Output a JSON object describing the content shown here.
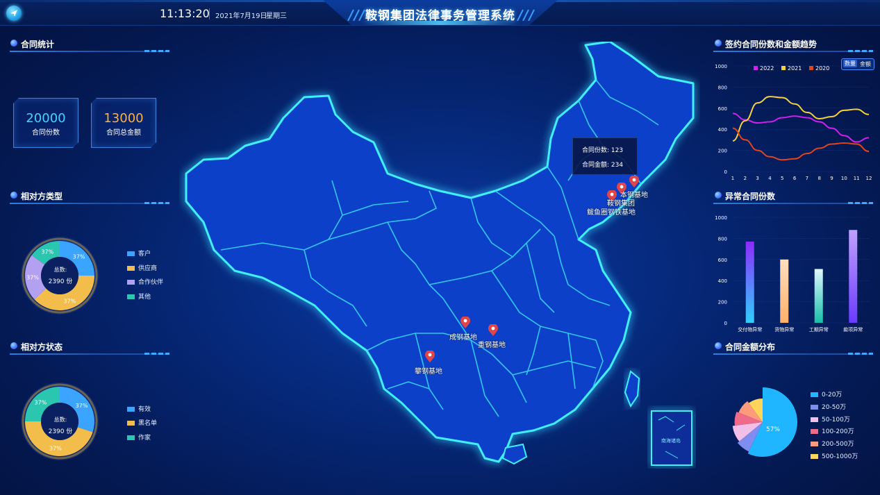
{
  "header": {
    "time": "11:13:20",
    "date": "2021年7月19日",
    "weekday": "星期三",
    "title": "鞍钢集团法律事务管理系统"
  },
  "left": {
    "contract_stats": {
      "title": "合同统计",
      "count_value": "20000",
      "count_label": "合同份数",
      "amount_value": "13000",
      "amount_label": "合同总金额"
    },
    "counterparty_type": {
      "title": "相对方类型",
      "center_label": "总数:",
      "center_value": "2390 份",
      "slice_labels": [
        "37%",
        "37%",
        "37%",
        "37%"
      ],
      "legend": [
        "客户",
        "供应商",
        "合作伙伴",
        "其他"
      ]
    },
    "counterparty_status": {
      "title": "相对方状态",
      "center_label": "总数:",
      "center_value": "2390 份",
      "slice_labels": [
        "37%",
        "37%",
        "37%"
      ],
      "legend": [
        "有效",
        "黑名单",
        "作家"
      ]
    }
  },
  "map": {
    "tooltip_count_label": "合同份数:",
    "tooltip_count_value": "123",
    "tooltip_amount_label": "合同金额:",
    "tooltip_amount_value": "234",
    "pins": [
      "本钢基地",
      "鞍钢集团",
      "鲅鱼圈钢铁基地",
      "成钢基地",
      "重钢基地",
      "攀钢基地"
    ],
    "inset_label": "南海诸岛"
  },
  "right": {
    "trend": {
      "title": "签约合同份数和金额趋势",
      "toggle_on": "数量",
      "toggle_off": "金额"
    },
    "abnormal": {
      "title": "异常合同份数"
    },
    "distribution": {
      "title": "合同金额分布",
      "slice_label": "57%",
      "legend": [
        "0-20万",
        "20-50万",
        "50-100万",
        "100-200万",
        "200-500万",
        "500-1000万"
      ]
    }
  },
  "colors": {
    "accent": "#2fd8ff",
    "kpi_count": "#47d1ff",
    "kpi_amount": "#ffb040",
    "c2022": "#d21ff0",
    "c2021": "#f6d23a",
    "c2020": "#e0451c",
    "pin": "#e0454a"
  },
  "chart_data": [
    {
      "type": "pie",
      "name_ref": "相对方类型",
      "labels": [
        "客户",
        "供应商",
        "合作伙伴",
        "其他"
      ],
      "values": [
        25,
        38,
        22,
        15
      ],
      "colors": [
        "#3ba4ff",
        "#f3bd4c",
        "#b3a0f0",
        "#2bc6b0"
      ]
    },
    {
      "type": "pie",
      "name_ref": "相对方状态",
      "labels": [
        "有效",
        "黑名单",
        "作家"
      ],
      "values": [
        30,
        45,
        25
      ],
      "colors": [
        "#3ba4ff",
        "#f3bd4c",
        "#2bc6b0"
      ]
    },
    {
      "type": "line",
      "x": [
        1,
        2,
        3,
        4,
        5,
        6,
        7,
        8,
        9,
        10,
        11,
        12
      ],
      "series": [
        {
          "name": "2022",
          "values": [
            550,
            490,
            460,
            470,
            510,
            525,
            510,
            470,
            410,
            340,
            280,
            320
          ]
        },
        {
          "name": "2021",
          "values": [
            290,
            480,
            650,
            710,
            700,
            640,
            560,
            500,
            520,
            580,
            590,
            540
          ]
        },
        {
          "name": "2020",
          "values": [
            410,
            300,
            200,
            140,
            110,
            120,
            170,
            220,
            260,
            270,
            260,
            190
          ]
        }
      ],
      "ylim": [
        0,
        1000
      ],
      "yticks": [
        0,
        200,
        400,
        600,
        800,
        1000
      ],
      "legend": "top"
    },
    {
      "type": "bar",
      "categories": [
        "交付物异常",
        "货物异常",
        "工期异常",
        "款项异常"
      ],
      "values": [
        770,
        600,
        510,
        880
      ],
      "ylim": [
        0,
        1000
      ],
      "yticks": [
        0,
        200,
        400,
        600,
        800,
        1000
      ]
    },
    {
      "type": "pie",
      "name_ref": "合同金额分布",
      "labels": [
        "0-20万",
        "20-50万",
        "50-100万",
        "100-200万",
        "200-500万",
        "500-1000万"
      ],
      "values": [
        57,
        7,
        9,
        8,
        9,
        10
      ],
      "colors": [
        "#1fb6ff",
        "#7f8cf0",
        "#f2bfe8",
        "#f06a8a",
        "#ff9a7a",
        "#ffd45a"
      ]
    }
  ]
}
